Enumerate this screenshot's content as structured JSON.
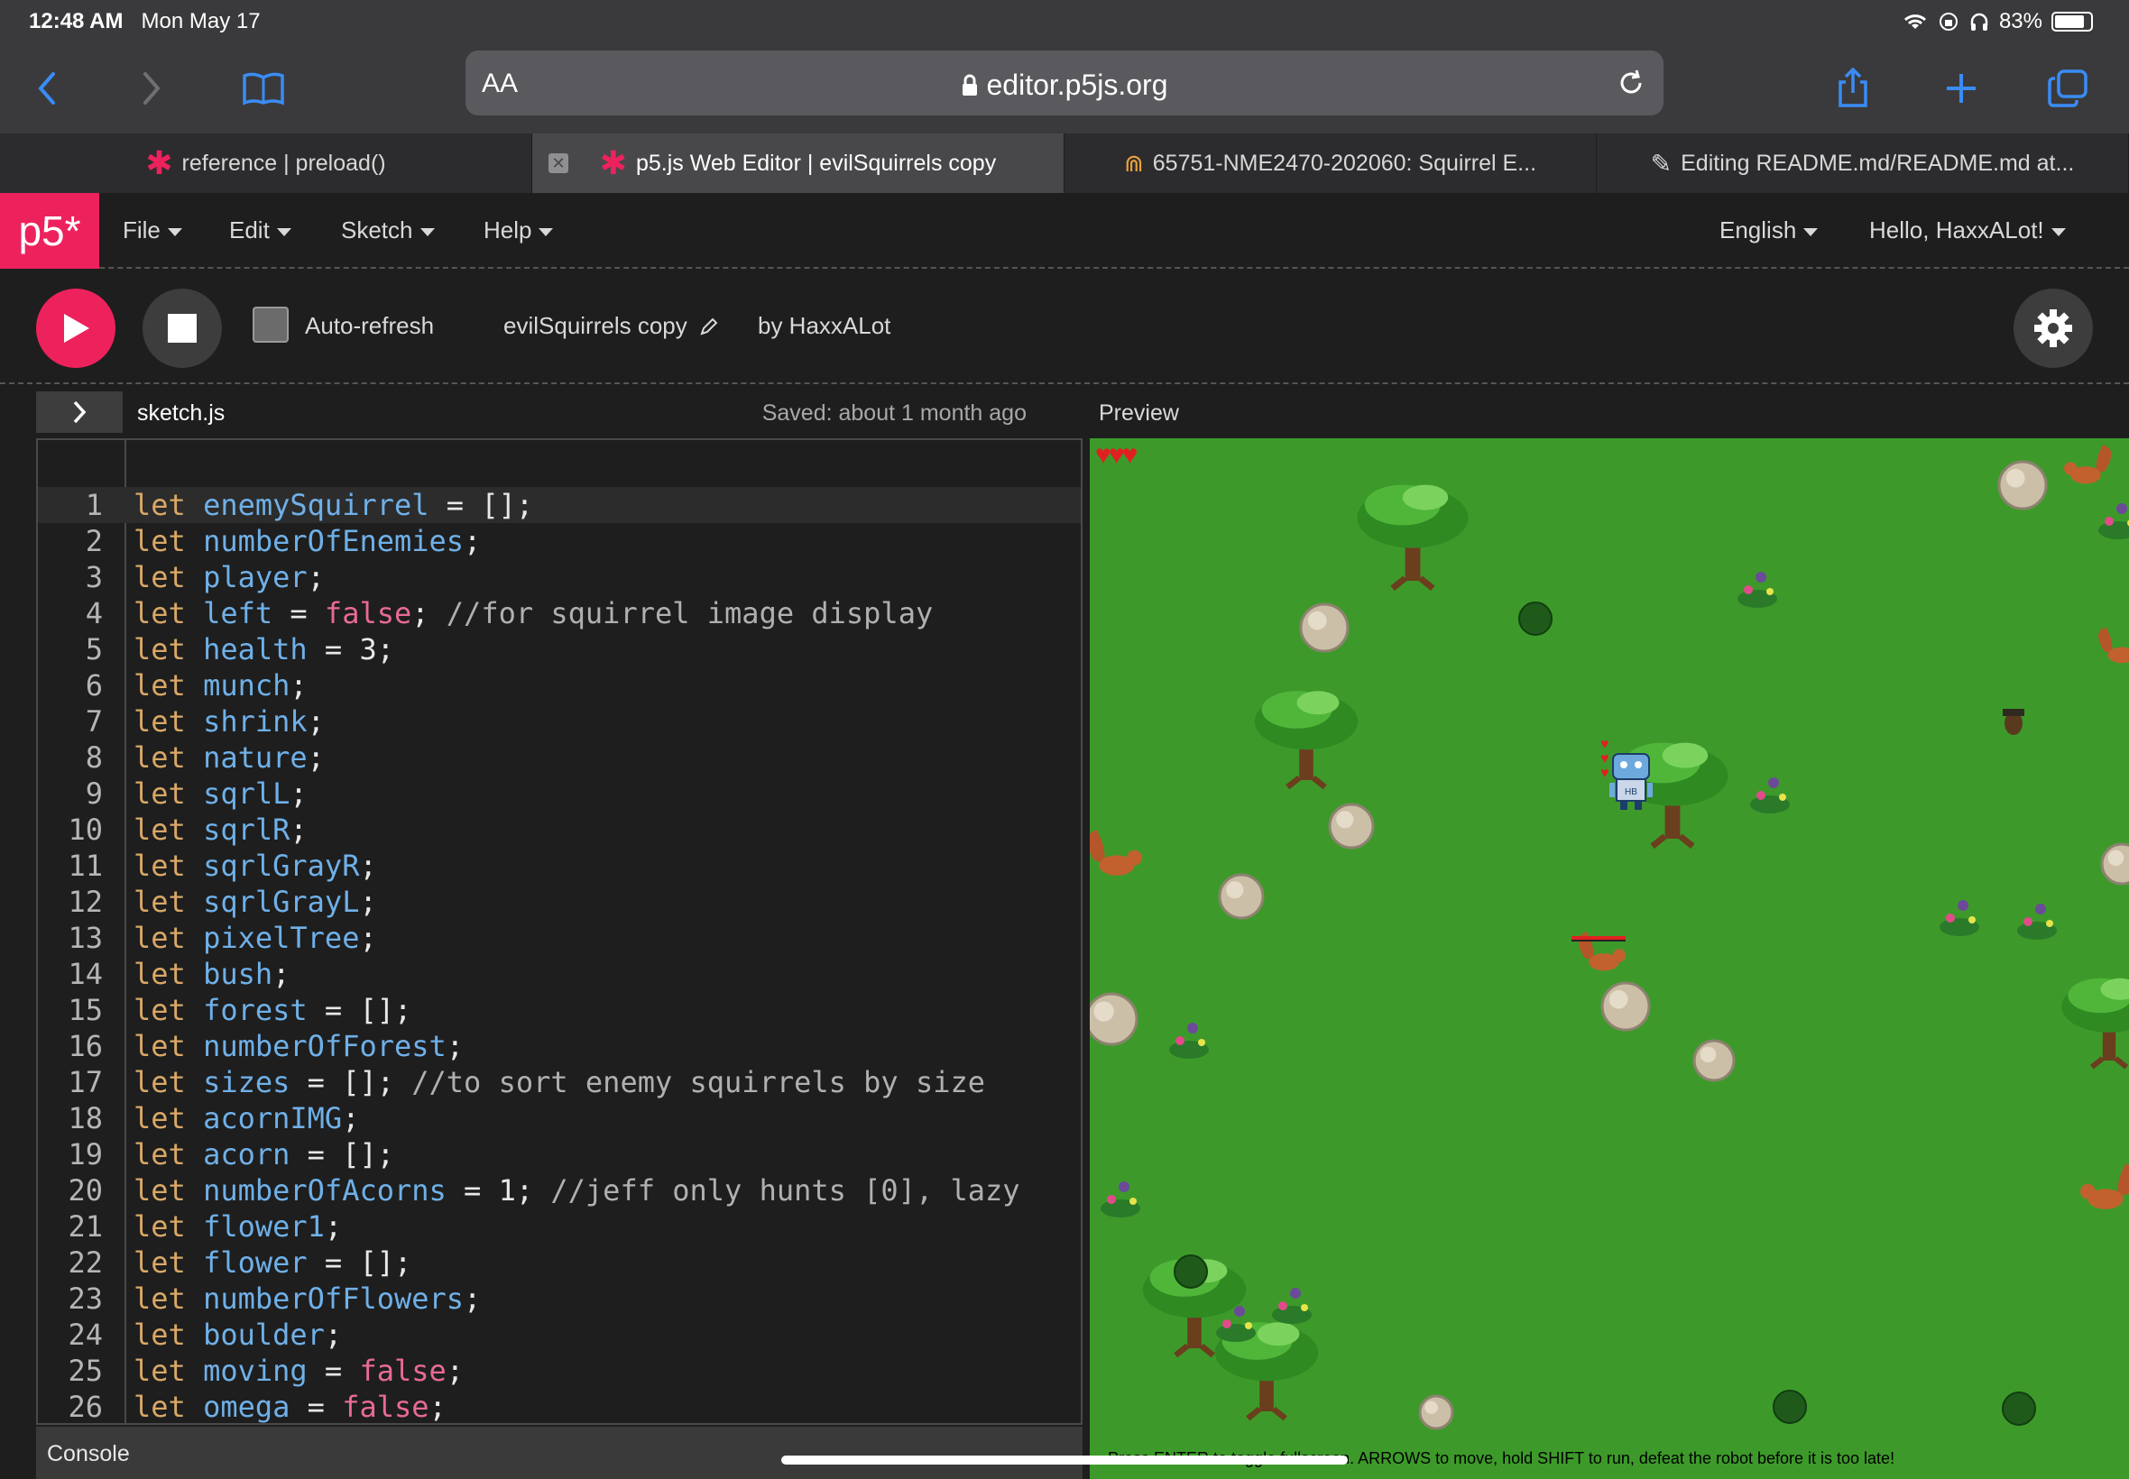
{
  "status": {
    "time": "12:48 AM",
    "date": "Mon May 17",
    "battery": "83%"
  },
  "browser": {
    "url": "editor.p5js.org",
    "aa": "AA",
    "tabs": [
      {
        "label": "reference | preload()",
        "active": false
      },
      {
        "label": "p5.js Web Editor | evilSquirrels copy",
        "active": true
      },
      {
        "label": "65751-NME2470-202060: Squirrel E...",
        "active": false
      },
      {
        "label": "Editing README.md/README.md at...",
        "active": false
      }
    ]
  },
  "p5nav": {
    "logo": "p5*",
    "menus": [
      "File",
      "Edit",
      "Sketch",
      "Help"
    ],
    "language": "English",
    "user": "Hello, HaxxALot!"
  },
  "toolbar": {
    "autorefresh": "Auto-refresh",
    "sketch_name": "evilSquirrels copy",
    "author": "by HaxxALot"
  },
  "editor": {
    "filename": "sketch.js",
    "saved": "Saved: about 1 month ago",
    "preview_label": "Preview",
    "console_label": "Console",
    "lines": [
      [
        [
          "kw",
          "let"
        ],
        [
          "t",
          " "
        ],
        [
          "var",
          "enemySquirrel"
        ],
        [
          "t",
          " = [];"
        ]
      ],
      [
        [
          "kw",
          "let"
        ],
        [
          "t",
          " "
        ],
        [
          "var",
          "numberOfEnemies"
        ],
        [
          "t",
          ";"
        ]
      ],
      [
        [
          "kw",
          "let"
        ],
        [
          "t",
          " "
        ],
        [
          "var",
          "player"
        ],
        [
          "t",
          ";"
        ]
      ],
      [
        [
          "kw",
          "let"
        ],
        [
          "t",
          " "
        ],
        [
          "var",
          "left"
        ],
        [
          "t",
          " = "
        ],
        [
          "bool",
          "false"
        ],
        [
          "t",
          "; "
        ],
        [
          "cm",
          "//for squirrel image display"
        ]
      ],
      [
        [
          "kw",
          "let"
        ],
        [
          "t",
          " "
        ],
        [
          "var",
          "health"
        ],
        [
          "t",
          " = 3;"
        ]
      ],
      [
        [
          "kw",
          "let"
        ],
        [
          "t",
          " "
        ],
        [
          "var",
          "munch"
        ],
        [
          "t",
          ";"
        ]
      ],
      [
        [
          "kw",
          "let"
        ],
        [
          "t",
          " "
        ],
        [
          "var",
          "shrink"
        ],
        [
          "t",
          ";"
        ]
      ],
      [
        [
          "kw",
          "let"
        ],
        [
          "t",
          " "
        ],
        [
          "var",
          "nature"
        ],
        [
          "t",
          ";"
        ]
      ],
      [
        [
          "kw",
          "let"
        ],
        [
          "t",
          " "
        ],
        [
          "var",
          "sqrlL"
        ],
        [
          "t",
          ";"
        ]
      ],
      [
        [
          "kw",
          "let"
        ],
        [
          "t",
          " "
        ],
        [
          "var",
          "sqrlR"
        ],
        [
          "t",
          ";"
        ]
      ],
      [
        [
          "kw",
          "let"
        ],
        [
          "t",
          " "
        ],
        [
          "var",
          "sqrlGrayR"
        ],
        [
          "t",
          ";"
        ]
      ],
      [
        [
          "kw",
          "let"
        ],
        [
          "t",
          " "
        ],
        [
          "var",
          "sqrlGrayL"
        ],
        [
          "t",
          ";"
        ]
      ],
      [
        [
          "kw",
          "let"
        ],
        [
          "t",
          " "
        ],
        [
          "var",
          "pixelTree"
        ],
        [
          "t",
          ";"
        ]
      ],
      [
        [
          "kw",
          "let"
        ],
        [
          "t",
          " "
        ],
        [
          "var",
          "bush"
        ],
        [
          "t",
          ";"
        ]
      ],
      [
        [
          "kw",
          "let"
        ],
        [
          "t",
          " "
        ],
        [
          "var",
          "forest"
        ],
        [
          "t",
          " = [];"
        ]
      ],
      [
        [
          "kw",
          "let"
        ],
        [
          "t",
          " "
        ],
        [
          "var",
          "numberOfForest"
        ],
        [
          "t",
          ";"
        ]
      ],
      [
        [
          "kw",
          "let"
        ],
        [
          "t",
          " "
        ],
        [
          "var",
          "sizes"
        ],
        [
          "t",
          " = []; "
        ],
        [
          "cm",
          "//to sort enemy squirrels by size"
        ]
      ],
      [
        [
          "kw",
          "let"
        ],
        [
          "t",
          " "
        ],
        [
          "var",
          "acornIMG"
        ],
        [
          "t",
          ";"
        ]
      ],
      [
        [
          "kw",
          "let"
        ],
        [
          "t",
          " "
        ],
        [
          "var",
          "acorn"
        ],
        [
          "t",
          " = [];"
        ]
      ],
      [
        [
          "kw",
          "let"
        ],
        [
          "t",
          " "
        ],
        [
          "var",
          "numberOfAcorns"
        ],
        [
          "t",
          " = 1; "
        ],
        [
          "cm",
          "//jeff only hunts [0], lazy"
        ]
      ],
      [
        [
          "kw",
          "let"
        ],
        [
          "t",
          " "
        ],
        [
          "var",
          "flower1"
        ],
        [
          "t",
          ";"
        ]
      ],
      [
        [
          "kw",
          "let"
        ],
        [
          "t",
          " "
        ],
        [
          "var",
          "flower"
        ],
        [
          "t",
          " = [];"
        ]
      ],
      [
        [
          "kw",
          "let"
        ],
        [
          "t",
          " "
        ],
        [
          "var",
          "numberOfFlowers"
        ],
        [
          "t",
          ";"
        ]
      ],
      [
        [
          "kw",
          "let"
        ],
        [
          "t",
          " "
        ],
        [
          "var",
          "boulder"
        ],
        [
          "t",
          ";"
        ]
      ],
      [
        [
          "kw",
          "let"
        ],
        [
          "t",
          " "
        ],
        [
          "var",
          "moving"
        ],
        [
          "t",
          " = "
        ],
        [
          "bool",
          "false"
        ],
        [
          "t",
          ";"
        ]
      ],
      [
        [
          "kw",
          "let"
        ],
        [
          "t",
          " "
        ],
        [
          "var",
          "omega"
        ],
        [
          "t",
          " = "
        ],
        [
          "bool",
          "false"
        ],
        [
          "t",
          ";"
        ]
      ]
    ]
  },
  "game": {
    "hearts": "♥♥♥",
    "player_label": "HB",
    "instructions": "Press ENTER to toggle fullscreen. ARROWS to move, hold SHIFT to run, defeat the robot before it is too late!",
    "colors": {
      "grass": "#3d9a2a",
      "accent": "#ed225d"
    }
  }
}
